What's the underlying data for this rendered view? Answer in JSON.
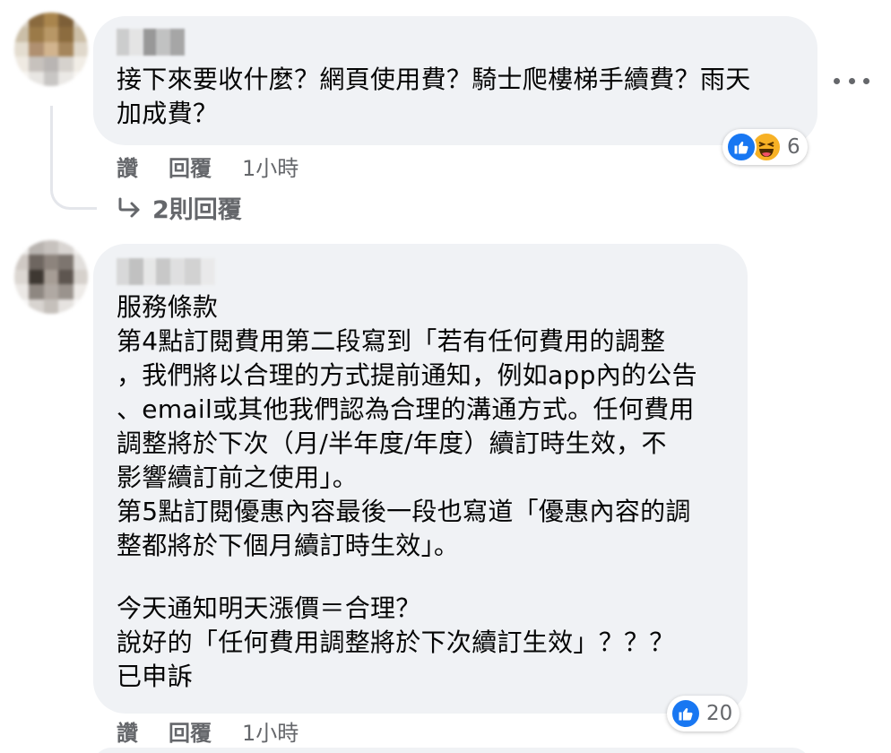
{
  "comments": [
    {
      "text": "接下來要收什麼？網頁使用費？騎士爬樓梯手續費？雨天\n加成費？",
      "actions": {
        "like": "讚",
        "reply": "回覆",
        "time": "1小時"
      },
      "reactions": {
        "icons": [
          "like-icon",
          "haha-icon"
        ],
        "count": "6"
      },
      "replies_label": "2則回覆"
    },
    {
      "text": "服務條款\n第4點訂閱費用第二段寫到「若有任何費用的調整\n，我們將以合理的方式提前通知，例如app內的公告\n、email或其他我們認為合理的溝通方式。任何費用\n調整將於下次（月/半年度/年度）續訂時生效，不\n影響續訂前之使用」。\n第5點訂閱優惠內容最後一段也寫道「優惠內容的調\n整都將於下個月續訂時生效」。",
      "text2": "今天通知明天漲價＝合理？\n說好的「任何費用調整將於下次續訂生效」？？？\n已申訴",
      "actions": {
        "like": "讚",
        "reply": "回覆",
        "time": "1小時"
      },
      "reactions": {
        "icons": [
          "like-icon"
        ],
        "count": "20"
      }
    }
  ],
  "colors": {
    "bubble": "#f0f2f5",
    "meta": "#65676b",
    "like_blue": "#1877f2",
    "haha_yellow": "#f7b125"
  }
}
